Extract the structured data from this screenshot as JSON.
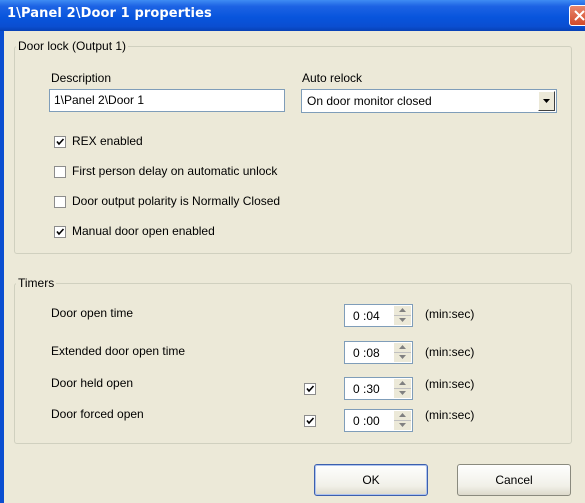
{
  "window": {
    "title": "1\\Panel 2\\Door 1 properties"
  },
  "door_lock": {
    "legend": "Door lock (Output 1)",
    "description_label": "Description",
    "description_value": "1\\Panel 2\\Door 1",
    "auto_relock_label": "Auto relock",
    "auto_relock_value": "On door monitor closed",
    "options": [
      {
        "label": "REX enabled",
        "checked": true
      },
      {
        "label": "First person delay on automatic unlock",
        "checked": false
      },
      {
        "label": "Door output polarity is Normally Closed",
        "checked": false
      },
      {
        "label": "Manual door open enabled",
        "checked": true
      }
    ]
  },
  "timers": {
    "legend": "Timers",
    "rows": [
      {
        "label": "Door open time",
        "value": "0 :04",
        "unit": "(min:sec)",
        "has_checkbox": false
      },
      {
        "label": "Extended  door open time",
        "value": "0 :08",
        "unit": "(min:sec)",
        "has_checkbox": false
      },
      {
        "label": "Door held open",
        "value": "0 :30",
        "unit": "(min:sec)",
        "has_checkbox": true,
        "checked": true
      },
      {
        "label": "Door forced open",
        "value": "0 :00",
        "unit": "(min:sec)",
        "has_checkbox": true,
        "checked": true
      }
    ]
  },
  "buttons": {
    "ok": "OK",
    "cancel": "Cancel"
  },
  "icons": {
    "close": "close-icon",
    "dropdown": "chevron-down-icon",
    "check": "checkmark-icon",
    "spin_up": "spin-up-icon",
    "spin_down": "spin-down-icon"
  },
  "colors": {
    "titlebar": "#0855dd",
    "window_bg": "#ece9d8",
    "close_button": "#d24a2a"
  }
}
